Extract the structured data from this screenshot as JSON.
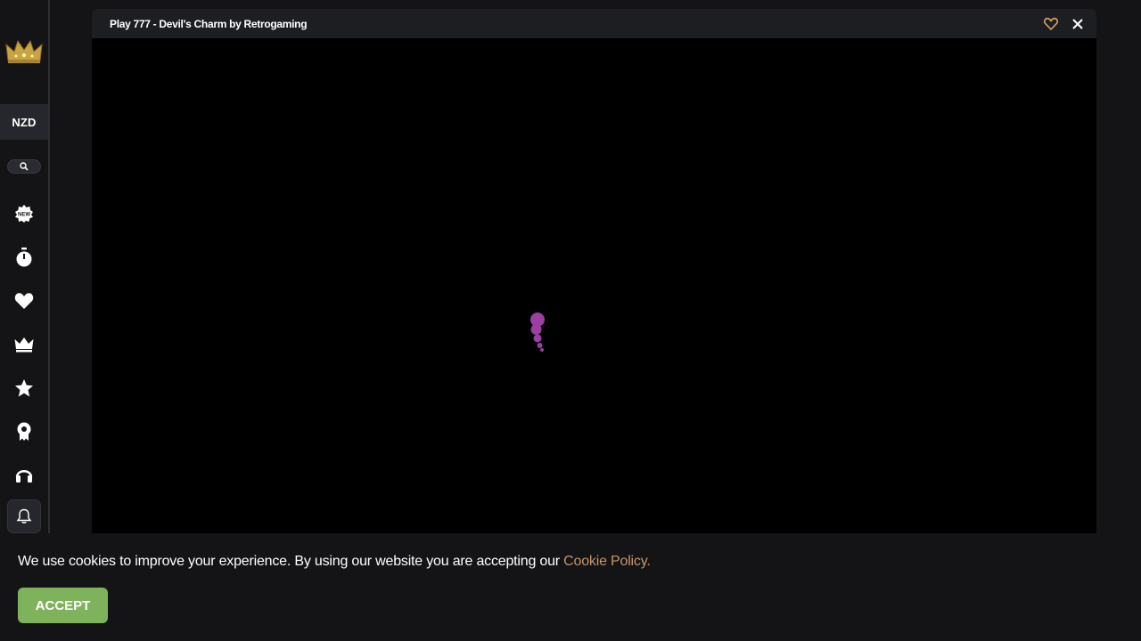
{
  "sidebar": {
    "logo_icon": "crown-logo",
    "currency": "NZD",
    "search_icon": "search-icon",
    "items": [
      {
        "icon": "new-badge-icon"
      },
      {
        "icon": "stopwatch-icon"
      },
      {
        "icon": "heart-icon"
      },
      {
        "icon": "crown-icon"
      },
      {
        "icon": "star-icon"
      },
      {
        "icon": "award-ribbon-icon"
      },
      {
        "icon": "headset-icon"
      }
    ],
    "notifications_icon": "bell-icon"
  },
  "game": {
    "title": "Play 777 - Devil's Charm by Retrogaming",
    "favorite_icon": "heart-outline-icon",
    "close_icon": "close-icon",
    "loader_color": "#9b3fa0"
  },
  "cookie": {
    "message": "We use cookies to improve your experience. By using our website you are accepting our ",
    "link_label": "Cookie Policy.",
    "accept_label": "ACCEPT"
  },
  "colors": {
    "background": "#141417",
    "accent_link": "#c5956a",
    "accept_button": "#7eb35c",
    "favorite": "#d9a06a"
  }
}
